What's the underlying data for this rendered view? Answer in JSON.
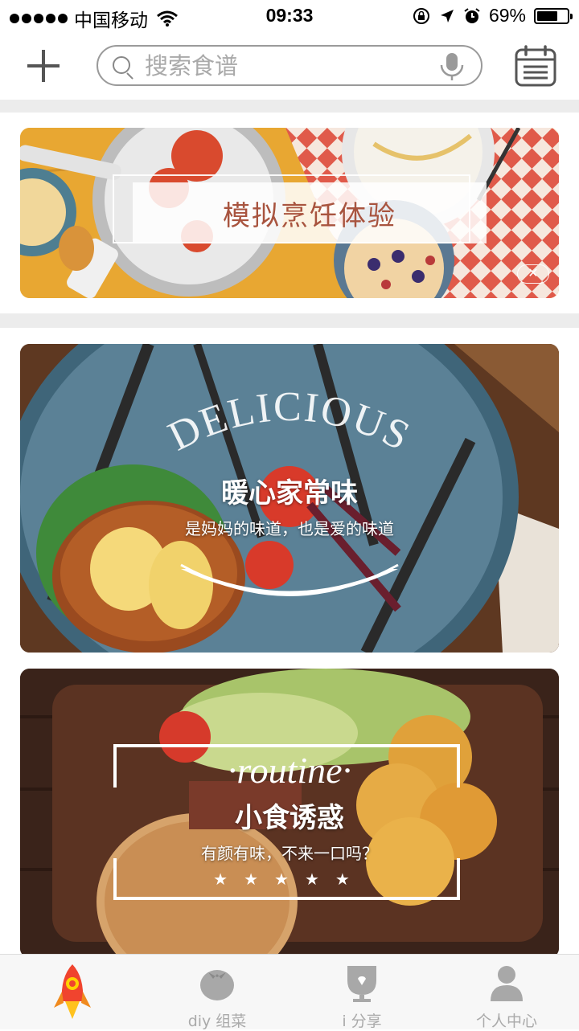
{
  "status_bar": {
    "carrier": "中国移动",
    "time": "09:33",
    "battery_pct": "69%",
    "battery_level": 0.69,
    "icons": [
      "signal-dots-icon",
      "wifi-icon",
      "rotation-lock-icon",
      "location-icon",
      "alarm-icon",
      "battery-icon"
    ]
  },
  "header": {
    "add_icon": "plus-icon",
    "search_placeholder": "搜索食谱",
    "search_icon": "search-icon",
    "voice_icon": "microphone-icon",
    "calendar_icon": "calendar-icon"
  },
  "banner": {
    "title": "模拟烹饪体验",
    "close_icon": "close-icon"
  },
  "cards": [
    {
      "overlay_word": "DELICIOUS",
      "title": "暖心家常味",
      "subtitle": "是妈妈的味道，也是爱的味道"
    },
    {
      "overlay_word": "·routine·",
      "title": "小食诱惑",
      "subtitle": "有颜有味，不来一口吗？",
      "stars": "★★★★★",
      "rating": 5
    }
  ],
  "tabbar": {
    "items": [
      {
        "label": "",
        "icon": "rocket-icon",
        "active": true
      },
      {
        "label": "diy 组菜",
        "icon": "tomato-icon",
        "active": false
      },
      {
        "label": "i 分享",
        "icon": "share-cup-icon",
        "active": false
      },
      {
        "label": "个人中心",
        "icon": "person-icon",
        "active": false
      }
    ]
  },
  "colors": {
    "banner_text": "#a8543f",
    "tab_inactive": "#aaaaaa",
    "divider": "#ececec"
  }
}
